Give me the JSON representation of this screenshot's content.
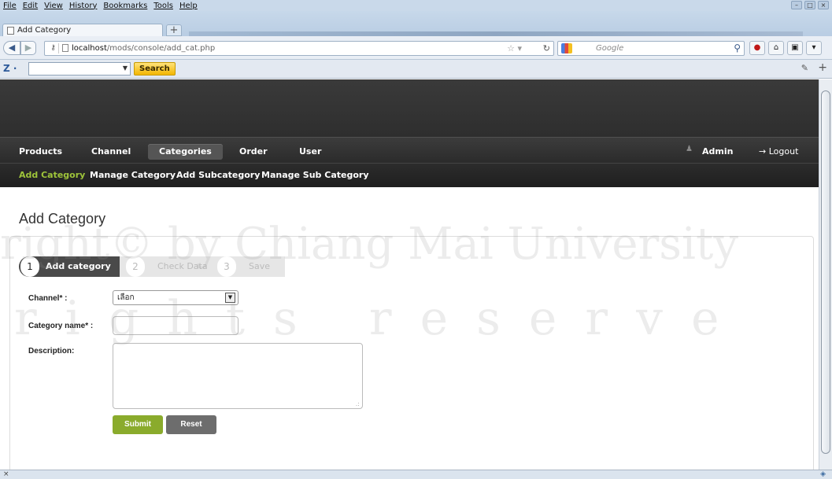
{
  "browser": {
    "menu": [
      "File",
      "Edit",
      "View",
      "History",
      "Bookmarks",
      "Tools",
      "Help"
    ],
    "tab_title": "Add Category",
    "new_tab": "+",
    "url_host": "localhost",
    "url_path": "/mods/console/add_cat.php",
    "search_engine": "Google",
    "toolbar_search_button": "Search",
    "status_left": "×"
  },
  "header": {
    "nav": [
      "Products",
      "Channel",
      "Categories",
      "Order",
      "User"
    ],
    "active_nav": "Categories",
    "user": "Admin",
    "logout": "→ Logout",
    "subnav": [
      "Add Category",
      "Manage Category",
      "Add Subcategory",
      "Manage Sub Category"
    ],
    "active_subnav": "Add Category"
  },
  "page": {
    "title": "Add Category",
    "steps": [
      {
        "num": "1",
        "label": "Add category"
      },
      {
        "num": "2",
        "label": "Check Data"
      },
      {
        "num": "3",
        "label": "Save"
      }
    ],
    "form": {
      "channel_label": "Channel* :",
      "channel_value": "เลือก",
      "category_label": "Category name* :",
      "category_value": "",
      "description_label": "Description:",
      "submit": "Submit",
      "reset": "Reset"
    }
  },
  "watermark": {
    "line1": "right© by Chiang Mai University",
    "line2": "rights reserve"
  },
  "colors": {
    "accent_green": "#8aab2c",
    "header_dark": "#2e2e2e",
    "active_subnav": "#9ec43a"
  }
}
